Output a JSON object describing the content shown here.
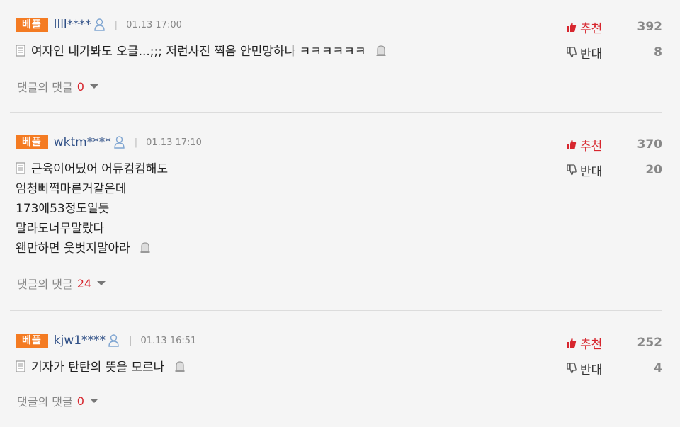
{
  "colors": {
    "badge": "#f47b22",
    "username": "#2f4f86",
    "up_vote": "#d7262e",
    "reply_count": "#d7262e",
    "divider": "#dcdcdc"
  },
  "comments": [
    {
      "badge": "베플",
      "username": "llll****",
      "timestamp": "01.13 17:00",
      "sep": "|",
      "lines": [
        "여자인 내가봐도 오글...;;; 저런사진 찍음 안민망하나 ㅋㅋㅋㅋㅋㅋ"
      ],
      "replies_label": "댓글의 댓글",
      "replies_count": "0",
      "upvote_label": "추천",
      "upvote_count": "392",
      "downvote_label": "반대",
      "downvote_count": "8"
    },
    {
      "badge": "베플",
      "username": "wktm****",
      "timestamp": "01.13 17:10",
      "sep": "|",
      "lines": [
        "근육이어딨어 어듀컴컴해도",
        "엄청삐쩍마른거같은데",
        "173에53정도일듯",
        "말라도너무말랐다",
        "왠만하면 웃벗지말아라"
      ],
      "replies_label": "댓글의 댓글",
      "replies_count": "24",
      "upvote_label": "추천",
      "upvote_count": "370",
      "downvote_label": "반대",
      "downvote_count": "20"
    },
    {
      "badge": "베플",
      "username": "kjw1****",
      "timestamp": "01.13 16:51",
      "sep": "|",
      "lines": [
        "기자가 탄탄의 뜻을 모르나"
      ],
      "replies_label": "댓글의 댓글",
      "replies_count": "0",
      "upvote_label": "추천",
      "upvote_count": "252",
      "downvote_label": "반대",
      "downvote_count": "4"
    }
  ]
}
